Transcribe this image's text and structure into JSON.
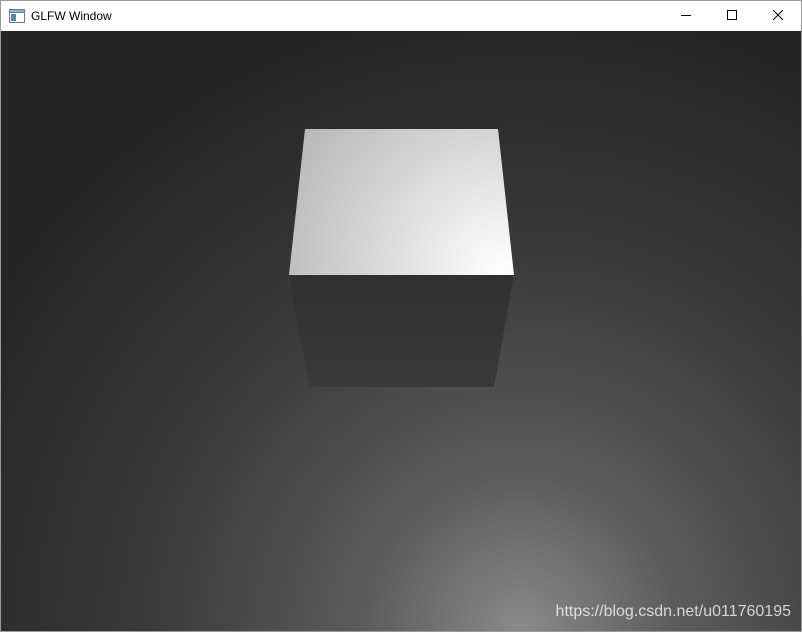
{
  "window": {
    "title": "GLFW Window",
    "controls": {
      "minimize": "minimize-icon",
      "maximize": "maximize-icon",
      "close": "close-icon"
    }
  },
  "scene": {
    "background_dark": "#262626",
    "background_light": "#6a6a6a",
    "cube_top_light": "#f4f4f4",
    "cube_top_dark": "#bdbdbd",
    "cube_front": "#353535",
    "watermark": "https://blog.csdn.net/u011760195"
  }
}
